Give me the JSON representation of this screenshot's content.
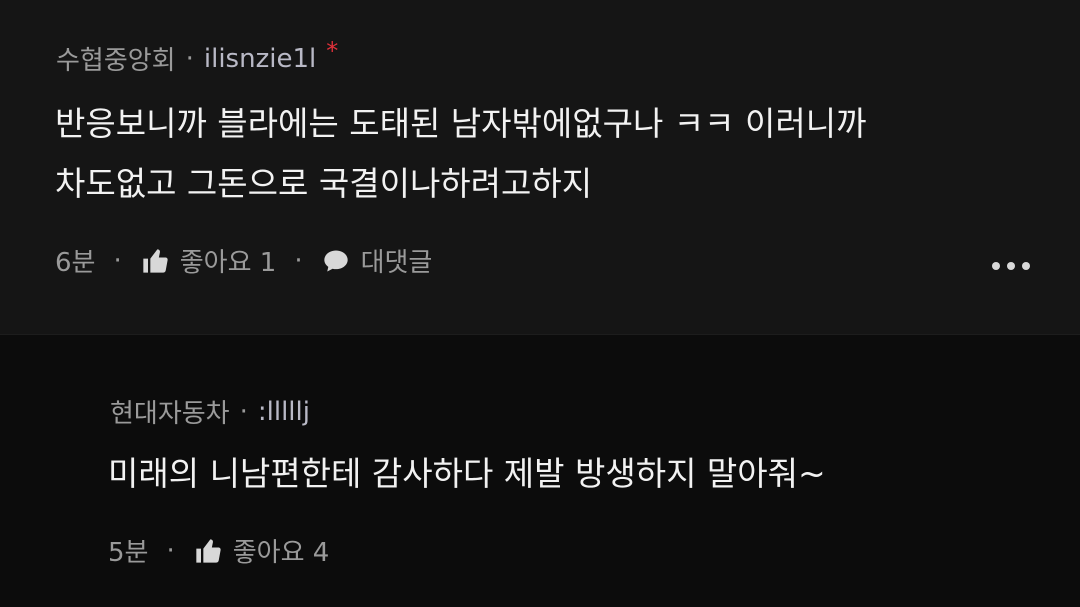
{
  "comments": [
    {
      "author_org": "수협중앙회",
      "author_handle": "ilisnzie1l",
      "badge": "*",
      "lines": [
        "반응보니까 블라에는 도태된 남자밖에없구나 ㅋㅋ 이러니까",
        "차도없고 그돈으로 국결이나하려고하지"
      ],
      "time": "6분",
      "like_label": "좋아요 1",
      "reply_label": "대댓글"
    },
    {
      "author_org": "현대자동차",
      "author_handle": ":lllllj",
      "lines": [
        "미래의 니남편한테 감사하다 제발 방생하지 말아줘~"
      ],
      "time": "5분",
      "like_label": "좋아요 4"
    }
  ],
  "icons": {
    "like": "thumbs-up-icon",
    "reply": "speech-bubble-icon",
    "more": "more-dots-icon"
  },
  "colors": {
    "badge": "#e0303a",
    "background": "#151515"
  }
}
